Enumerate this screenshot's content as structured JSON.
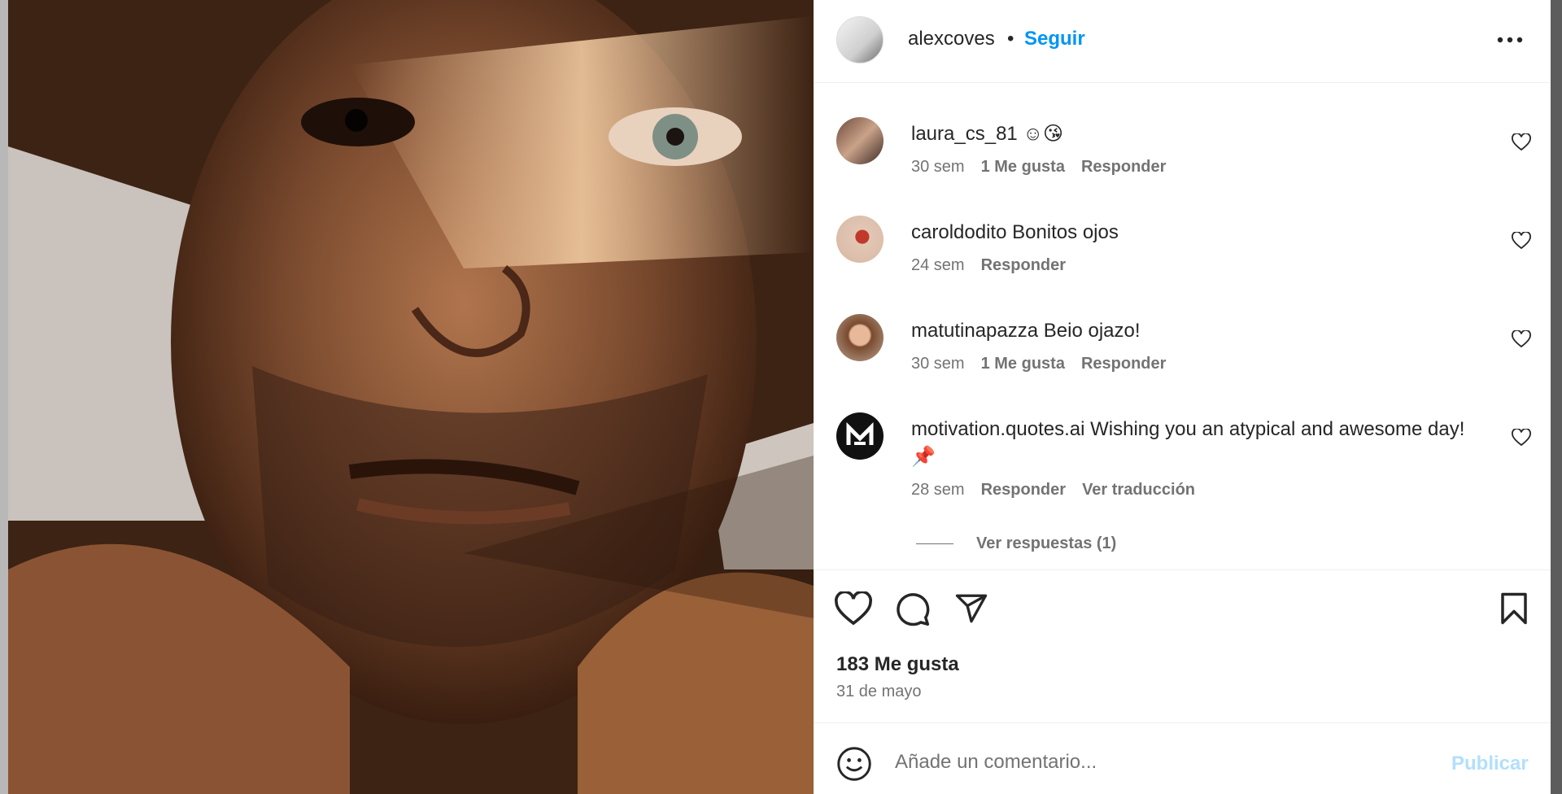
{
  "post": {
    "username": "alexcoves",
    "separator": "•",
    "follow_label": "Seguir",
    "more_icon": "more-horizontal-icon"
  },
  "comments": [
    {
      "username": "laura_cs_81",
      "text": "☺😘",
      "time": "30 sem",
      "likes": "1 Me gusta",
      "reply": "Responder",
      "translate": ""
    },
    {
      "username": "caroldodito",
      "text": "Bonitos ojos",
      "time": "24 sem",
      "likes": "",
      "reply": "Responder",
      "translate": ""
    },
    {
      "username": "matutinapazza",
      "text": "Beio ojazo!",
      "time": "30 sem",
      "likes": "1 Me gusta",
      "reply": "Responder",
      "translate": ""
    },
    {
      "username": "motivation.quotes.ai",
      "text": "Wishing you an atypical and awesome day!📌",
      "time": "28 sem",
      "likes": "",
      "reply": "Responder",
      "translate": "Ver traducción"
    }
  ],
  "view_replies": "Ver respuestas (1)",
  "actions": {
    "like_icon": "heart-icon",
    "comment_icon": "comment-icon",
    "share_icon": "send-icon",
    "save_icon": "bookmark-icon"
  },
  "likes_count": "183 Me gusta",
  "date": "31 de mayo",
  "composer": {
    "placeholder": "Añade un comentario...",
    "publish_label": "Publicar"
  },
  "colors": {
    "accent": "#0095f6",
    "publish_disabled": "#b2dffc",
    "text": "#262626",
    "secondary": "#737373"
  }
}
